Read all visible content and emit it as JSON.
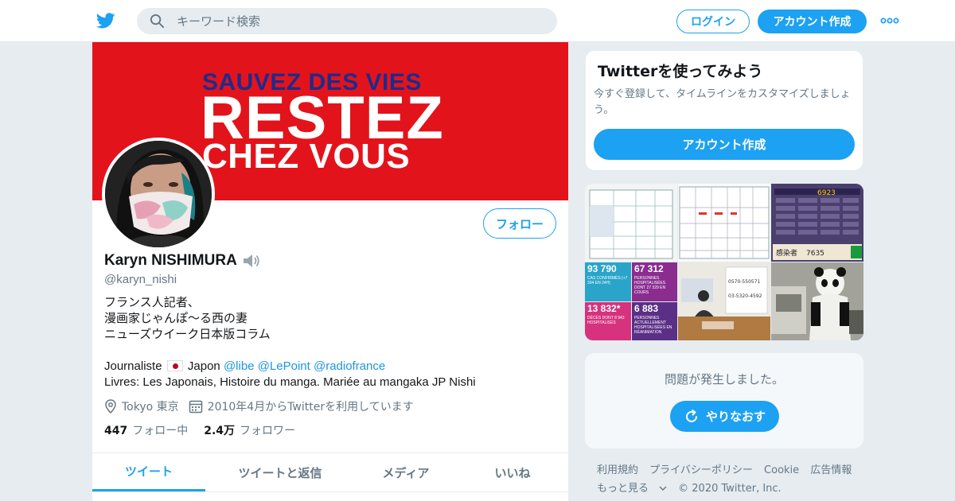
{
  "header": {
    "search_placeholder": "キーワード検索",
    "login_label": "ログイン",
    "signup_label": "アカウント作成"
  },
  "profile": {
    "banner": {
      "line1": "SAUVEZ DES VIES",
      "line2": "RESTEZ",
      "line3": "CHEZ VOUS"
    },
    "follow_label": "フォロー",
    "name": "Karyn NISHIMURA",
    "handle": "@karyn_nishi",
    "bio_lines": [
      "フランス人記者、",
      "漫画家じゃんぽ〜る西の妻",
      "ニューズウイーク日本版コラム"
    ],
    "bio_journalist": "Journaliste",
    "bio_japon": "Japon",
    "bio_links": [
      "@libe",
      "@LePoint",
      "@radiofrance"
    ],
    "bio_livres": "Livres: Les Japonais,  Histoire du manga. Mariée au mangaka JP Nishi",
    "location": "Tokyo 東京",
    "joined": "2010年4月からTwitterを利用しています",
    "following_count": "447",
    "following_label": "フォロー中",
    "followers_count": "2.4万",
    "followers_label": "フォロワー",
    "tabs": [
      "ツイート",
      "ツイートと返信",
      "メディア",
      "いいね"
    ]
  },
  "signup_card": {
    "title": "Twitterを使ってみよう",
    "text": "今すぐ登録して、タイムラインをカスタマイズしましょう。",
    "button": "アカウント作成"
  },
  "media_tiles": {
    "t4_num": "93 790",
    "t4_text": "CAS CONFIRMÉS (+7 334 EN 24H)",
    "t5_num": "67 312",
    "t5_text": "PERSONNES HOSPITALISÉES DONT 27 329 EN COURS",
    "t6_num": "13 832*",
    "t6_text": "DÉCÈS DONT 8 943 HOSPITALISÉS",
    "t7_num": "6 883",
    "t7_text": "PERSONNES ACTUELLEMENT HOSPITALISÉES EN RÉANIMATION",
    "tv_number": "6923",
    "tv_label": "感染者",
    "tv_sub": "7635",
    "phone1": "0570-550571",
    "phone2": "03-5320-4592"
  },
  "error_box": {
    "message": "問題が発生しました。",
    "retry_label": "やりなおす"
  },
  "footer": {
    "links": [
      "利用規約",
      "プライバシーポリシー",
      "Cookie",
      "広告情報"
    ],
    "more": "もっと見る",
    "copyright": "© 2020 Twitter, Inc."
  },
  "colors": {
    "brand": "#1da1f2",
    "banner_red": "#e3131b",
    "banner_blue": "#1c2c8c"
  }
}
